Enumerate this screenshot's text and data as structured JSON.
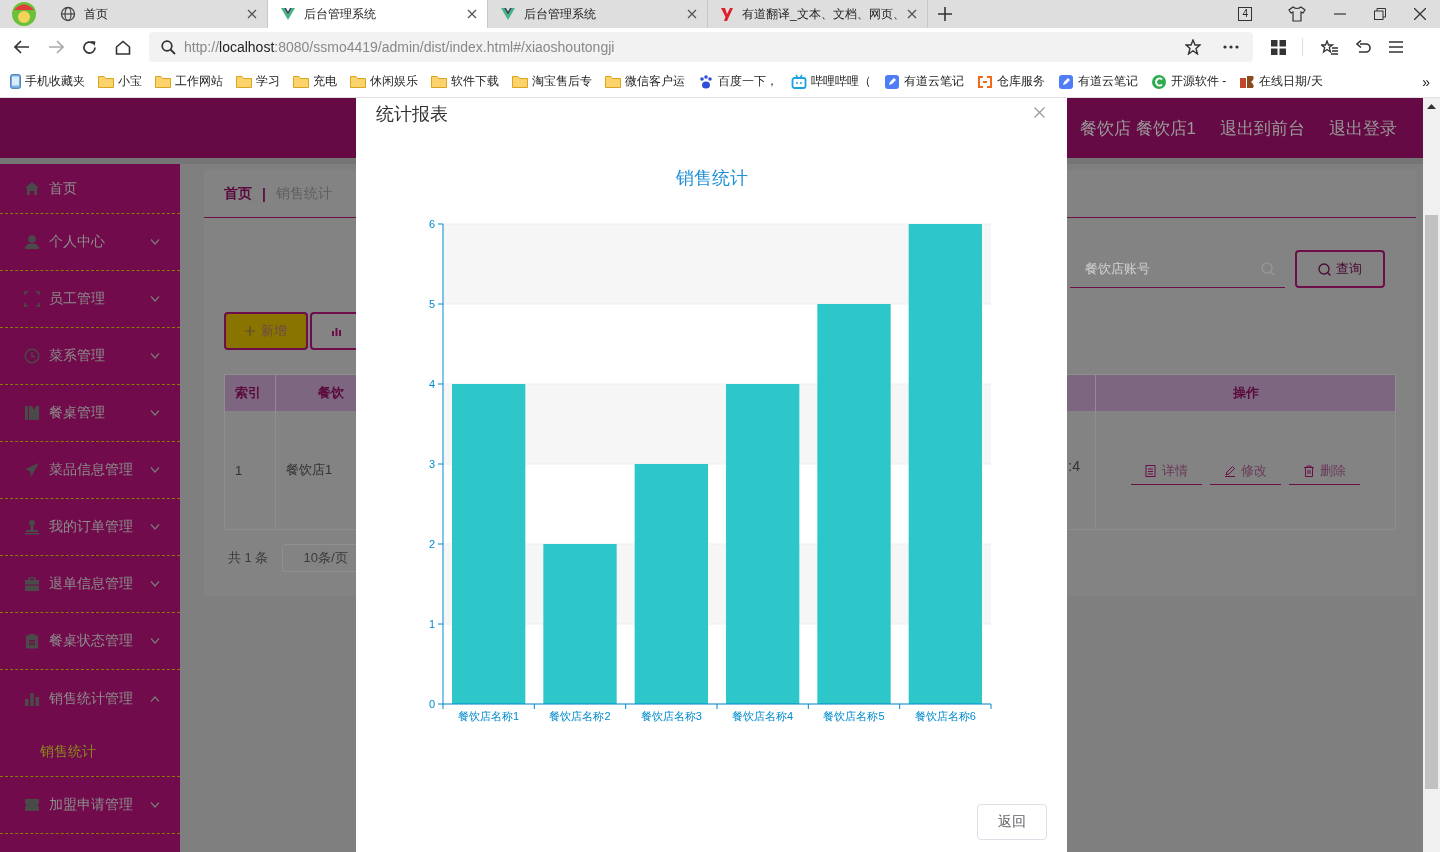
{
  "browser": {
    "tabs": [
      {
        "title": "首页",
        "selected": false
      },
      {
        "title": "后台管理系统",
        "selected": true
      },
      {
        "title": "后台管理系统",
        "selected": false
      },
      {
        "title": "有道翻译_文本、文档、网页、",
        "selected": false
      }
    ],
    "tab_count": "4",
    "nav": {
      "forward_disabled": true
    },
    "url": "http://**localhost**:8080/ssmo4419/admin/dist/index.html#/xiaoshoutongji",
    "bookmarks": [
      {
        "label": "手机收藏夹",
        "kind": "device"
      },
      {
        "label": "小宝",
        "kind": "folder"
      },
      {
        "label": "工作网站",
        "kind": "folder"
      },
      {
        "label": "学习",
        "kind": "folder"
      },
      {
        "label": "充电",
        "kind": "folder"
      },
      {
        "label": "休闲娱乐",
        "kind": "folder"
      },
      {
        "label": "软件下载",
        "kind": "folder"
      },
      {
        "label": "淘宝售后专",
        "kind": "folder"
      },
      {
        "label": "微信客户运",
        "kind": "folder"
      },
      {
        "label": "百度一下，",
        "kind": "site"
      },
      {
        "label": "哔哩哔哩（",
        "kind": "site"
      },
      {
        "label": "有道云笔记",
        "kind": "site"
      },
      {
        "label": "仓库服务",
        "kind": "site"
      },
      {
        "label": "有道云笔记",
        "kind": "site"
      },
      {
        "label": "开源软件 -",
        "kind": "site"
      },
      {
        "label": "在线日期/天",
        "kind": "site"
      }
    ],
    "bookmarks_overflow": "»"
  },
  "header": {
    "user": "餐饮店 餐饮店1",
    "links": [
      "退出到前台",
      "退出登录"
    ]
  },
  "sidebar": {
    "items": [
      {
        "label": "首页",
        "kind": "link"
      },
      {
        "label": "个人中心",
        "kind": "menu",
        "expanded": false
      },
      {
        "label": "员工管理",
        "kind": "menu",
        "expanded": false
      },
      {
        "label": "菜系管理",
        "kind": "menu",
        "expanded": false
      },
      {
        "label": "餐桌管理",
        "kind": "menu",
        "expanded": false
      },
      {
        "label": "菜品信息管理",
        "kind": "menu",
        "expanded": false
      },
      {
        "label": "我的订单管理",
        "kind": "menu",
        "expanded": false
      },
      {
        "label": "退单信息管理",
        "kind": "menu",
        "expanded": false
      },
      {
        "label": "餐桌状态管理",
        "kind": "menu",
        "expanded": false
      },
      {
        "label": "销售统计管理",
        "kind": "menu",
        "expanded": true,
        "children": [
          {
            "label": "销售统计",
            "selected": true
          }
        ]
      },
      {
        "label": "加盟申请管理",
        "kind": "menu",
        "expanded": false
      }
    ]
  },
  "breadcrumb": {
    "items": [
      "首页",
      "销售统计"
    ],
    "separator": "|"
  },
  "search": {
    "placeholder": "餐饮店账号",
    "button": "查询"
  },
  "toolbar": {
    "add_button": "新增"
  },
  "table": {
    "columns": [
      "索引",
      "餐饮",
      "操作"
    ],
    "rows": [
      {
        "index": "1",
        "column_2": "餐饮店1",
        "column_3": ":4",
        "actions": [
          "详情",
          "修改",
          "删除"
        ]
      }
    ]
  },
  "pagination": {
    "total": "共 1 条",
    "page_size": "10条/页"
  },
  "modal": {
    "title": "统计报表",
    "chart_data": {
      "type": "bar",
      "title": "销售统计",
      "categories": [
        "餐饮店名称1",
        "餐饮店名称2",
        "餐饮店名称3",
        "餐饮店名称4",
        "餐饮店名称5",
        "餐饮店名称6"
      ],
      "series": [
        {
          "color": "#2ec7c9",
          "values": [
            4,
            2,
            3,
            4,
            5,
            6
          ]
        }
      ],
      "grid": true,
      "ylim": [
        0,
        6
      ],
      "yticks": [
        0,
        1,
        2,
        3,
        4,
        5,
        6
      ]
    },
    "buttons": [
      "返回"
    ]
  }
}
